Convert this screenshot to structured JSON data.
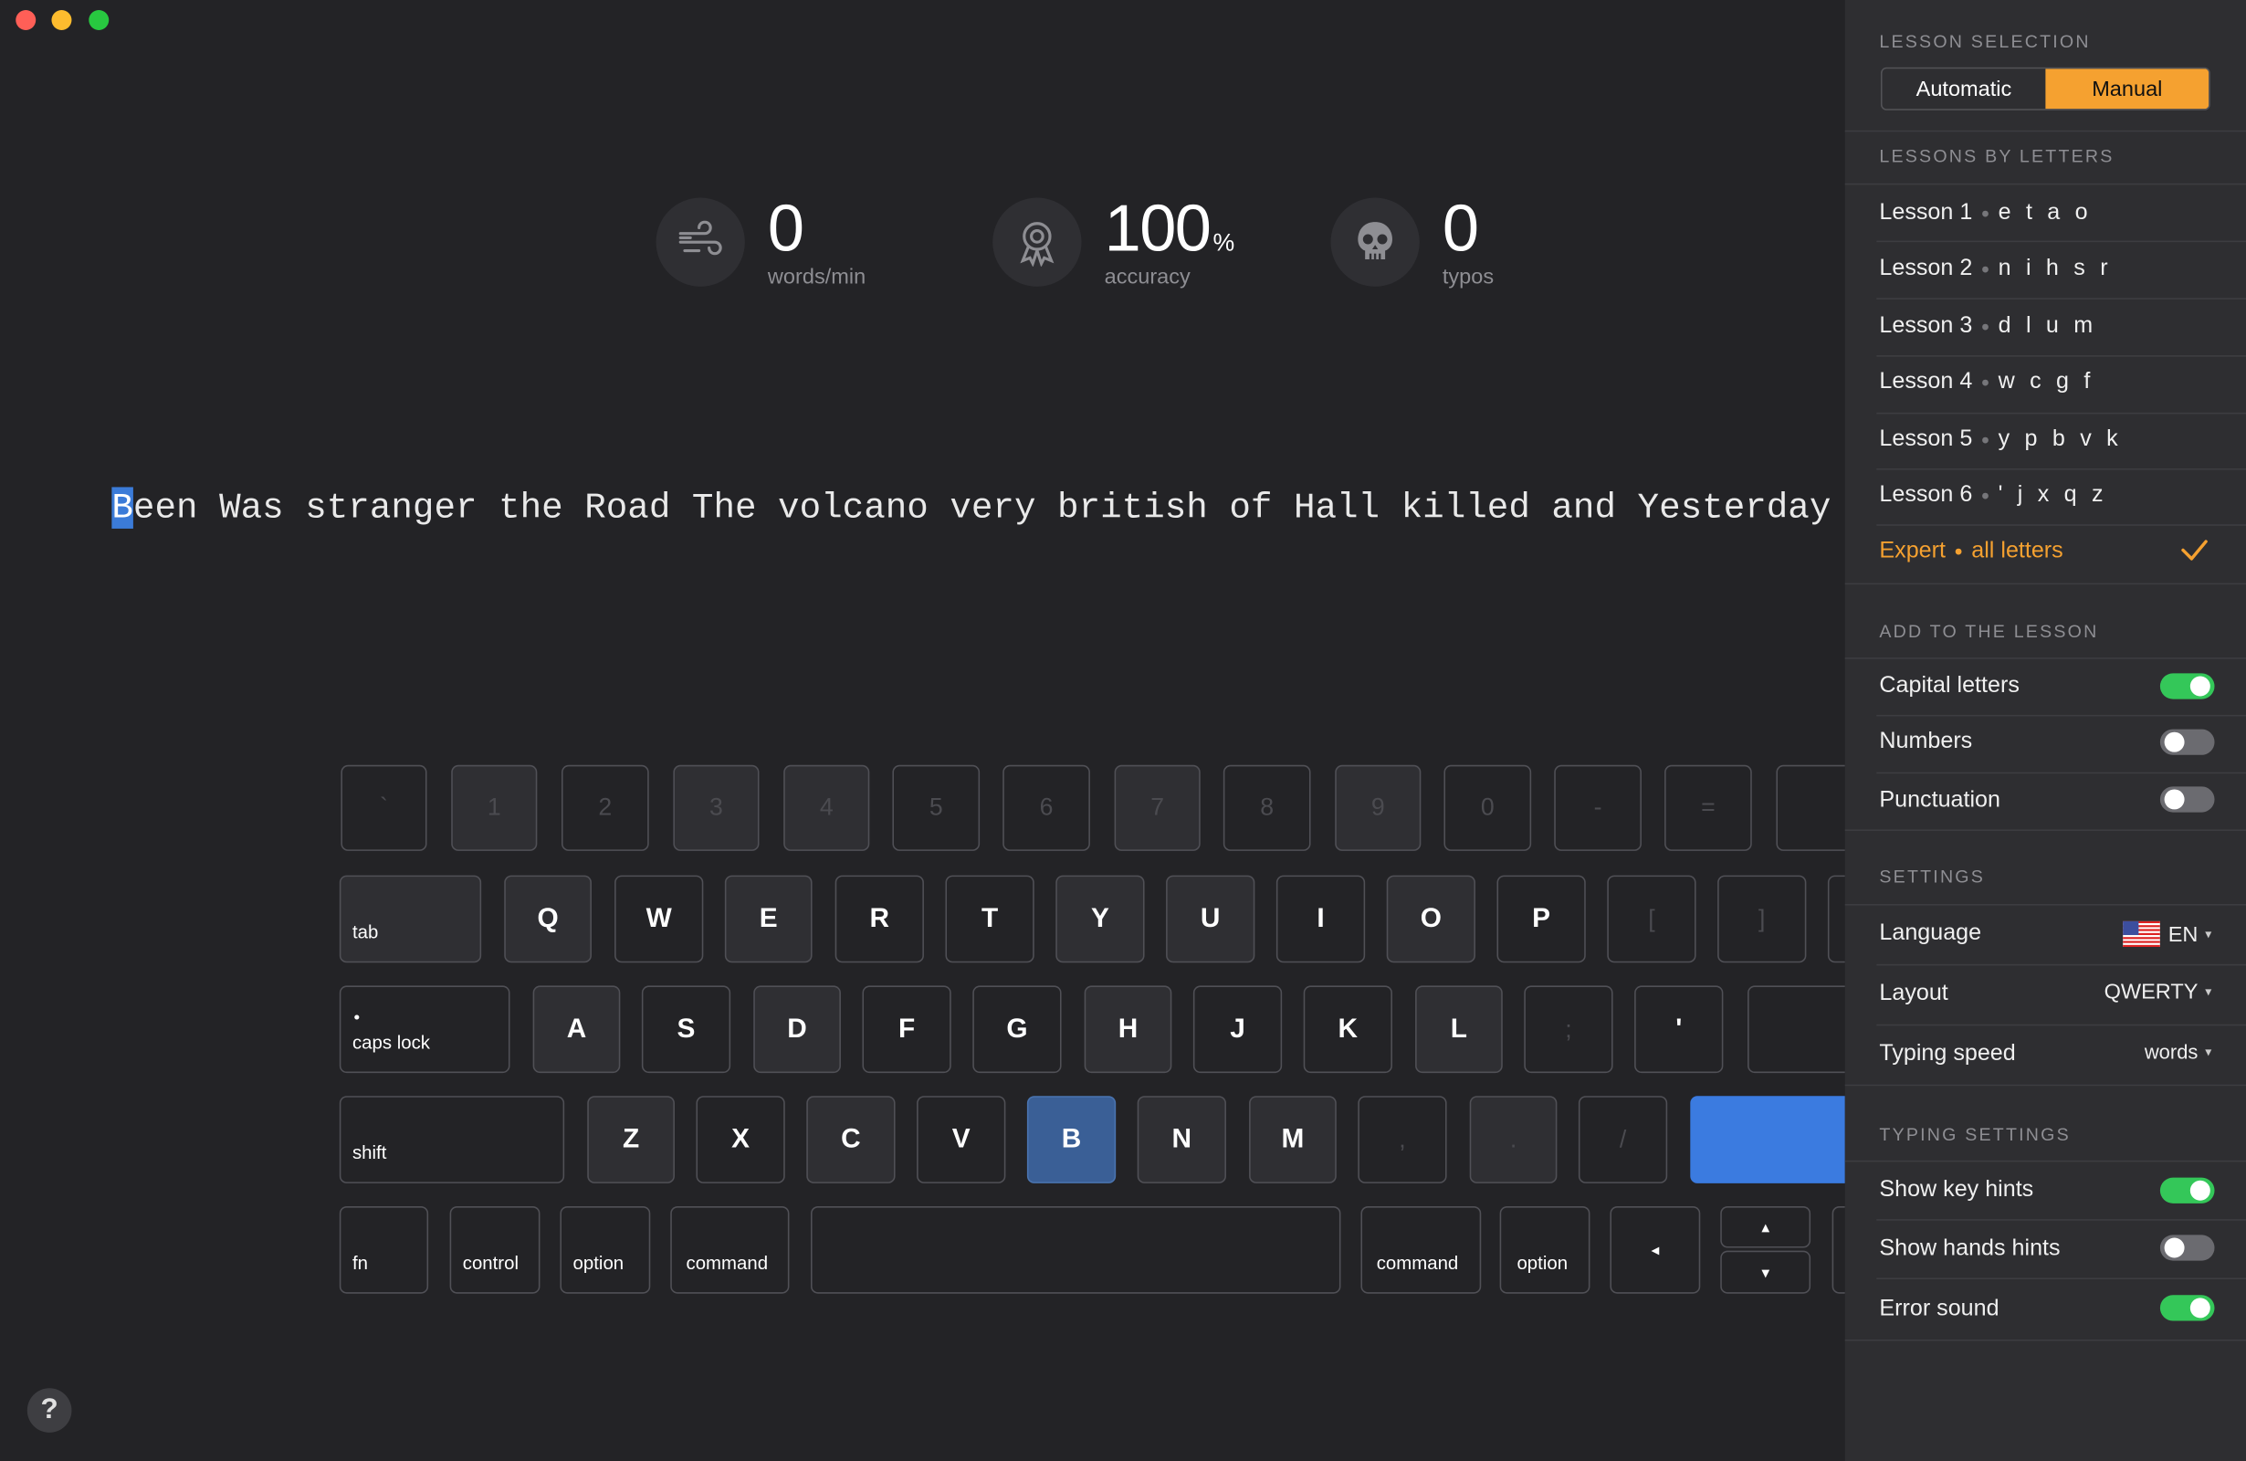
{
  "window": {
    "traffic_lights": {
      "close": "#ff5f57",
      "minimize": "#febc2e",
      "zoom": "#28c840"
    }
  },
  "stats": {
    "wpm": {
      "value": "0",
      "label": "words/min",
      "icon": "wind-icon"
    },
    "accuracy": {
      "value": "100",
      "unit": "%",
      "label": "accuracy",
      "icon": "award-icon"
    },
    "typos": {
      "value": "0",
      "label": "typos",
      "icon": "skull-icon"
    }
  },
  "typing_text": {
    "current_char": "B",
    "rest": "een Was stranger the Road The volcano very british of Hall killed and Yesterday any a"
  },
  "keyboard": {
    "row1": [
      "`",
      "1",
      "2",
      "3",
      "4",
      "5",
      "6",
      "7",
      "8",
      "9",
      "0",
      "-",
      "="
    ],
    "row2_mod": "tab",
    "row2": [
      "Q",
      "W",
      "E",
      "R",
      "T",
      "Y",
      "U",
      "I",
      "O",
      "P",
      "[",
      "]"
    ],
    "row3_mod": "caps lock",
    "row3_dot": "•",
    "row3": [
      "A",
      "S",
      "D",
      "F",
      "G",
      "H",
      "J",
      "K",
      "L",
      ";",
      "'"
    ],
    "row4_mod": "shift",
    "row4": [
      "Z",
      "X",
      "C",
      "V",
      "B",
      "N",
      "M",
      ",",
      ".",
      "/"
    ],
    "row5": {
      "fn": "fn",
      "control": "control",
      "option_l": "option",
      "command_l": "command",
      "command_r": "command",
      "option_r": "option",
      "left": "◂",
      "up": "▴",
      "down": "▾"
    },
    "highlighted_key": "B"
  },
  "help_label": "?",
  "panel": {
    "lesson_selection": {
      "heading": "LESSON SELECTION",
      "options": [
        "Automatic",
        "Manual"
      ],
      "selected": "Manual"
    },
    "lessons_heading": "LESSONS BY LETTERS",
    "lessons": [
      {
        "name": "Lesson 1",
        "letters": "e t a o"
      },
      {
        "name": "Lesson 2",
        "letters": "n i h s r"
      },
      {
        "name": "Lesson 3",
        "letters": "d l u m"
      },
      {
        "name": "Lesson 4",
        "letters": "w c g f"
      },
      {
        "name": "Lesson 5",
        "letters": "y p b v k"
      },
      {
        "name": "Lesson 6",
        "letters": "' j x q z"
      }
    ],
    "expert": {
      "name": "Expert",
      "letters": "all letters",
      "selected": true
    },
    "add_heading": "ADD TO THE LESSON",
    "add": [
      {
        "label": "Capital letters",
        "on": true
      },
      {
        "label": "Numbers",
        "on": false
      },
      {
        "label": "Punctuation",
        "on": false
      }
    ],
    "settings_heading": "SETTINGS",
    "settings": {
      "language": {
        "label": "Language",
        "value": "EN",
        "icon": "us-flag-icon"
      },
      "layout": {
        "label": "Layout",
        "value": "QWERTY"
      },
      "typing_speed": {
        "label": "Typing speed",
        "value": "words"
      }
    },
    "typing_heading": "TYPING SETTINGS",
    "typing": [
      {
        "label": "Show key hints",
        "on": true
      },
      {
        "label": "Show hands hints",
        "on": false
      },
      {
        "label": "Error sound",
        "on": true
      }
    ],
    "accent": "#f5a130",
    "toggle_on": "#34c759"
  }
}
